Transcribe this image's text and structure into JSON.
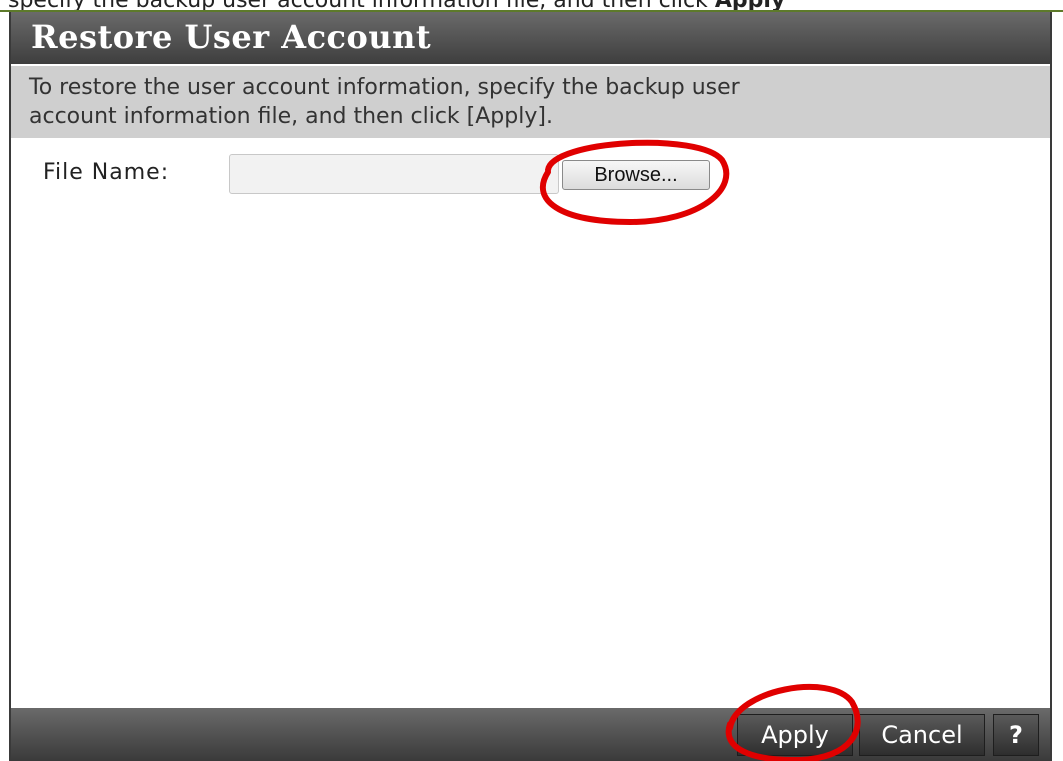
{
  "caption": {
    "lead_text": "specify the backup user account information file, and then click",
    "bold_text": "Apply"
  },
  "dialog": {
    "title": "Restore User Account",
    "instructions": "To restore the user account information, specify the backup user\naccount information file, and then click [Apply]."
  },
  "form": {
    "file_name_label": "File Name:",
    "file_name_value": "",
    "browse_label": "Browse..."
  },
  "footer": {
    "apply_label": "Apply",
    "cancel_label": "Cancel",
    "help_label": "?"
  },
  "colors": {
    "title_bar": "#4d4d4d",
    "instruction_band": "#cfcfcf",
    "annotation_circle": "#e00000"
  },
  "icons": {
    "help": "help-icon"
  }
}
